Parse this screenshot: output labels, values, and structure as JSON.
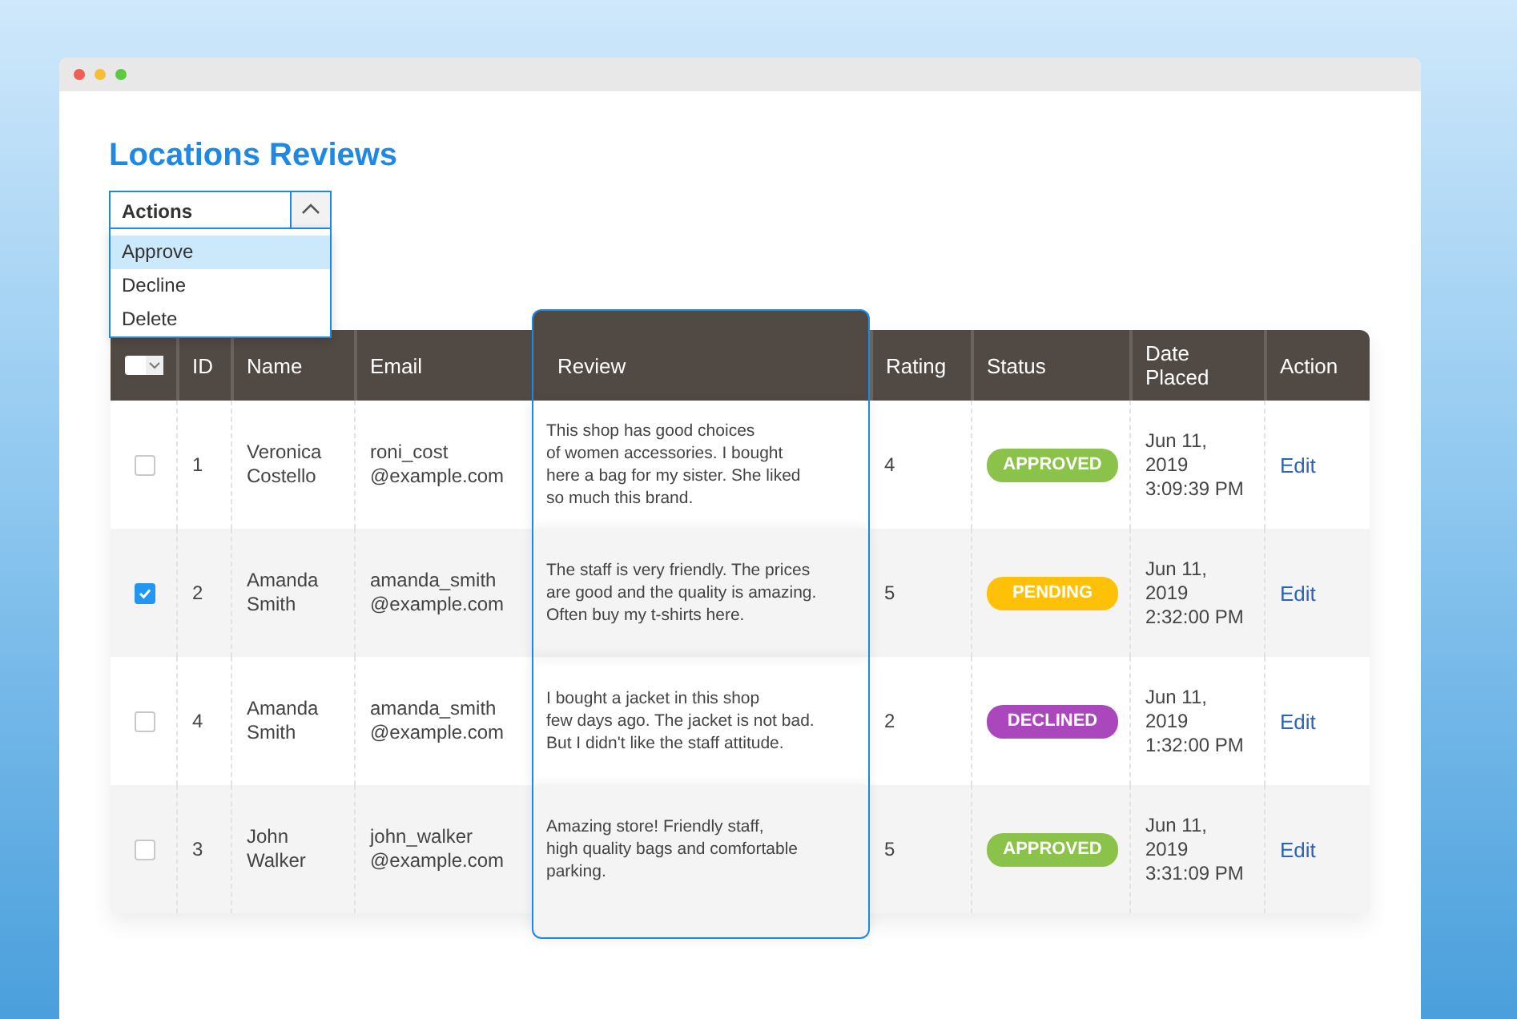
{
  "page": {
    "title": "Locations Reviews"
  },
  "select_all": {
    "checked": false
  },
  "actions": {
    "label": "Actions",
    "expanded": true,
    "items": [
      {
        "label": "Approve",
        "selected": true
      },
      {
        "label": "Decline",
        "selected": false
      },
      {
        "label": "Delete",
        "selected": false
      }
    ]
  },
  "table": {
    "columns": [
      "ID",
      "Name",
      "Email",
      "Review",
      "Rating",
      "Status",
      "Date Placed",
      "Action"
    ],
    "rows": [
      {
        "checked": false,
        "id": "1",
        "name": "Veronica Costello",
        "email": "roni_cost @example.com",
        "review": "This shop has good choices\nof women accessories. I bought\nhere a bag for my sister. She liked\nso much this brand.",
        "rating": "4",
        "status": "APPROVED",
        "color": "#8bc34a",
        "date": "Jun 11, 2019 3:09:39 PM",
        "action": "Edit"
      },
      {
        "checked": true,
        "id": "2",
        "name": "Amanda Smith",
        "email": "amanda_smith @example.com",
        "review": "The staff is very friendly. The prices\nare good and the quality is amazing.\nOften buy my t-shirts here.",
        "rating": "5",
        "status": "PENDING",
        "color": "#ffc107",
        "date": "Jun 11, 2019 2:32:00 PM",
        "action": "Edit"
      },
      {
        "checked": false,
        "id": "4",
        "name": "Amanda Smith",
        "email": "amanda_smith @example.com",
        "review": "I bought a jacket in this shop\nfew days ago. The jacket is not bad.\nBut I didn't like the staff attitude.",
        "rating": "2",
        "status": "DECLINED",
        "color": "#ab47bc",
        "date": "Jun 11, 2019 1:32:00 PM",
        "action": "Edit"
      },
      {
        "checked": false,
        "id": "3",
        "name": "John Walker",
        "email": "john_walker @example.com",
        "review": "Amazing store! Friendly staff,\nhigh quality bags and comfortable\nparking.",
        "rating": "5",
        "status": "APPROVED",
        "color": "#8bc34a",
        "date": "Jun 11, 2019 3:31:09 PM",
        "action": "Edit"
      }
    ]
  }
}
